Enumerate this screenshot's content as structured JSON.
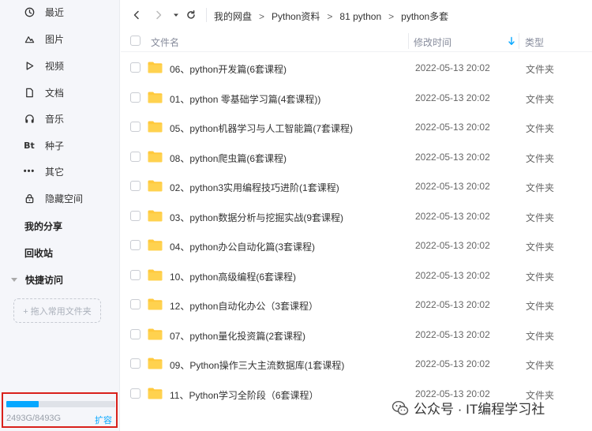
{
  "sidebar": {
    "items": [
      {
        "label": "最近",
        "icon": "clock-icon"
      },
      {
        "label": "图片",
        "icon": "image-icon"
      },
      {
        "label": "视频",
        "icon": "play-icon"
      },
      {
        "label": "文档",
        "icon": "document-icon"
      },
      {
        "label": "音乐",
        "icon": "headphones-icon"
      },
      {
        "label": "种子",
        "icon": "bt-icon",
        "glyph": "Bt"
      },
      {
        "label": "其它",
        "icon": "more-dots-icon",
        "glyph": "•••"
      },
      {
        "label": "隐藏空间",
        "icon": "lock-icon"
      }
    ],
    "my_share": "我的分享",
    "recycle_bin": "回收站",
    "quick_access": "快捷访问",
    "drop_zone": "+ 拖入常用文件夹",
    "storage": {
      "text": "2493G/8493G",
      "used_fraction": 0.2935,
      "expand_label": "扩容",
      "bar_color": "#06a7ff"
    }
  },
  "topbar": {
    "breadcrumbs": [
      "我的网盘",
      "Python资料",
      "81 python",
      "python多套"
    ],
    "separator": ">"
  },
  "table": {
    "headers": {
      "name": "文件名",
      "modified": "修改时间",
      "type": "类型"
    },
    "rows": [
      {
        "name": "06、python开发篇(6套课程)",
        "modified": "2022-05-13 20:02",
        "type": "文件夹"
      },
      {
        "name": "01、python 零基础学习篇(4套课程))",
        "modified": "2022-05-13 20:02",
        "type": "文件夹"
      },
      {
        "name": "05、python机器学习与人工智能篇(7套课程)",
        "modified": "2022-05-13 20:02",
        "type": "文件夹"
      },
      {
        "name": "08、python爬虫篇(6套课程)",
        "modified": "2022-05-13 20:02",
        "type": "文件夹"
      },
      {
        "name": "02、python3实用编程技巧进阶(1套课程)",
        "modified": "2022-05-13 20:02",
        "type": "文件夹"
      },
      {
        "name": "03、python数据分析与挖掘实战(9套课程)",
        "modified": "2022-05-13 20:02",
        "type": "文件夹"
      },
      {
        "name": "04、python办公自动化篇(3套课程)",
        "modified": "2022-05-13 20:02",
        "type": "文件夹"
      },
      {
        "name": "10、python高级编程(6套课程)",
        "modified": "2022-05-13 20:02",
        "type": "文件夹"
      },
      {
        "name": "12、python自动化办公（3套课程）",
        "modified": "2022-05-13 20:02",
        "type": "文件夹"
      },
      {
        "name": "07、python量化投资篇(2套课程)",
        "modified": "2022-05-13 20:02",
        "type": "文件夹"
      },
      {
        "name": "09、Python操作三大主流数据库(1套课程)",
        "modified": "2022-05-13 20:02",
        "type": "文件夹"
      },
      {
        "name": "11、Python学习全阶段（6套课程）",
        "modified": "2022-05-13 20:02",
        "type": "文件夹"
      }
    ]
  },
  "watermark": {
    "text": "公众号 · IT编程学习社"
  },
  "colors": {
    "accent": "#06a7ff",
    "folder": "#ffc93d",
    "highlight_border": "#d9211b",
    "sidebar_bg": "#f5f6fa"
  }
}
